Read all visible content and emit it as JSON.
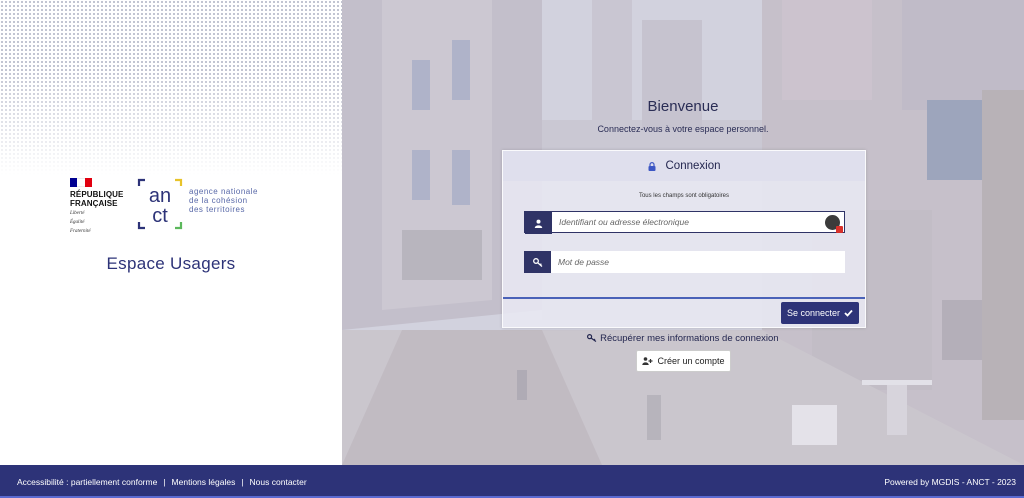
{
  "branding": {
    "republique": [
      "RÉPUBLIQUE",
      "FRANÇAISE"
    ],
    "devise": [
      "Liberté",
      "Égalité",
      "Fraternité"
    ],
    "anct_letters_top": "an",
    "anct_letters_bottom": "ct",
    "agency_lines": [
      "agence nationale",
      "de la cohésion",
      "des territoires"
    ],
    "espace_title": "Espace Usagers"
  },
  "welcome": {
    "title": "Bienvenue",
    "subtitle": "Connectez-vous à votre espace personnel."
  },
  "login": {
    "header": "Connexion",
    "required_note": "Tous les champs sont obligatoires",
    "username_placeholder": "Identifiant ou adresse électronique",
    "password_placeholder": "Mot de passe",
    "submit_label": "Se connecter"
  },
  "links": {
    "recover": "Récupérer mes informations de connexion",
    "create_account": "Créer un compte"
  },
  "footer": {
    "accessibility": "Accessibilité : partiellement conforme",
    "legal": "Mentions légales",
    "contact": "Nous contacter",
    "separator": "|",
    "powered": "Powered by MGDIS - ANCT - 2023"
  },
  "icons": {
    "lock": "lock-icon",
    "user": "user-icon",
    "key": "key-icon",
    "check": "check-icon",
    "add_user": "user-plus-icon",
    "password_manager": "password-manager-icon"
  },
  "colors": {
    "brand_navy": "#2d3378",
    "field_addon": "#2f3366",
    "accent_blue": "#4a62b8",
    "flag_blue": "#000091",
    "flag_red": "#e1000f"
  }
}
